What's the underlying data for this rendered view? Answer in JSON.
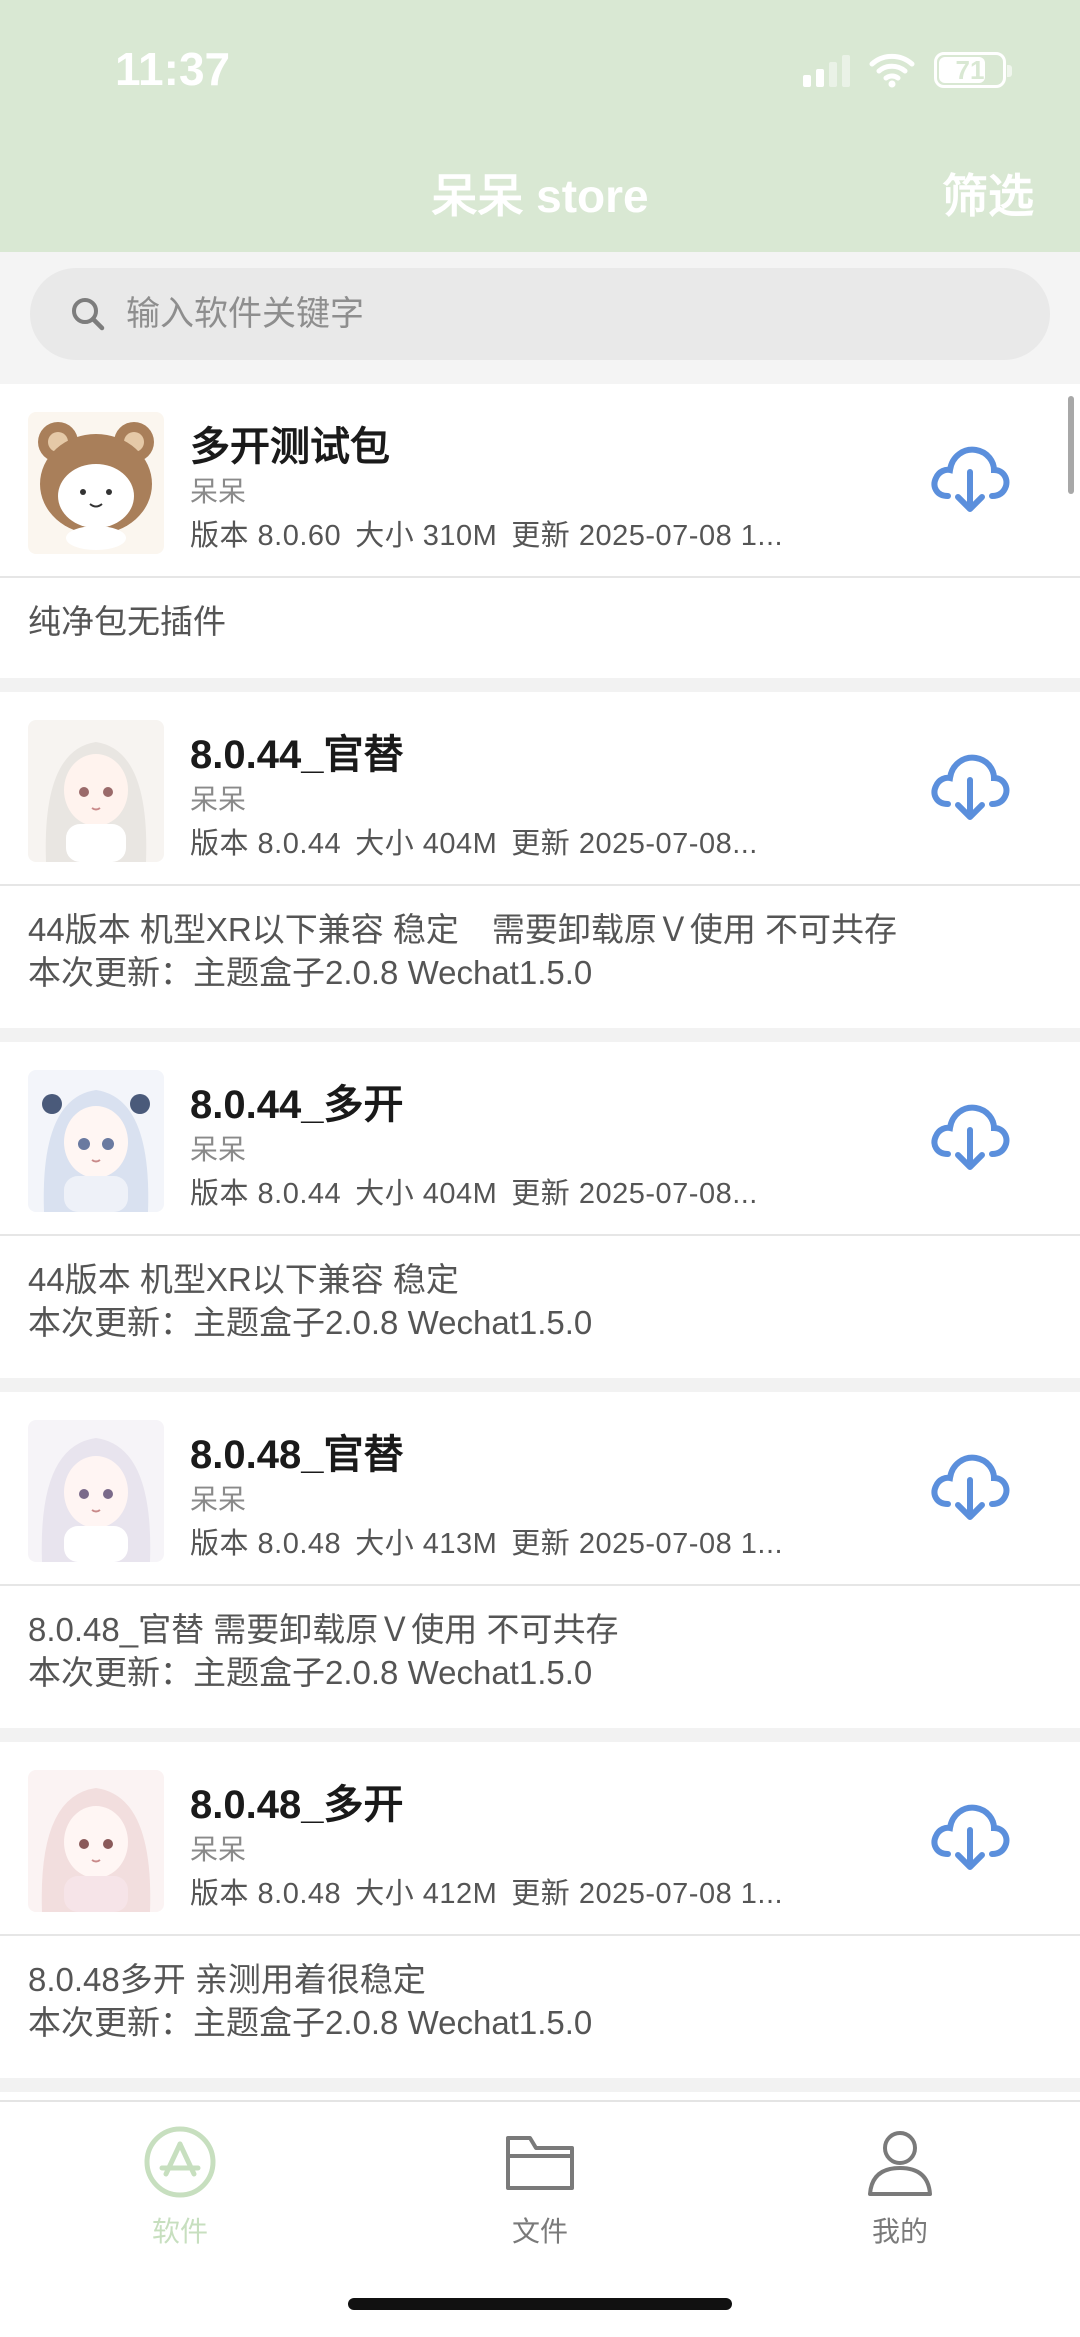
{
  "status_bar": {
    "time": "11:37",
    "battery": "71"
  },
  "header": {
    "title": "呆呆 store",
    "filter_label": "筛选"
  },
  "search": {
    "placeholder": "输入软件关键字",
    "value": ""
  },
  "apps": [
    {
      "name": "多开测试包",
      "author": "呆呆",
      "version": "版本 8.0.60",
      "size": "大小 310M",
      "updated": "更新 2025-07-08 1...",
      "desc_line1": "纯净包无插件",
      "desc_line2": "",
      "thumb_icon": "bear-hood-avatar"
    },
    {
      "name": "8.0.44_官替",
      "author": "呆呆",
      "version": "版本 8.0.44",
      "size": "大小 404M",
      "updated": "更新 2025-07-08...",
      "desc_line1": "44版本 机型XR以下兼容 稳定　需要卸载原Ｖ使用 不可共存",
      "desc_line2": "本次更新：主题盒子2.0.8 Wechat1.5.0",
      "thumb_icon": "anime-girl-avatar"
    },
    {
      "name": "8.0.44_多开",
      "author": "呆呆",
      "version": "版本 8.0.44",
      "size": "大小 404M",
      "updated": "更新 2025-07-08...",
      "desc_line1": "44版本 机型XR以下兼容 稳定",
      "desc_line2": "本次更新：主题盒子2.0.8 Wechat1.5.0",
      "thumb_icon": "anime-girl-avatar"
    },
    {
      "name": "8.0.48_官替",
      "author": "呆呆",
      "version": "版本 8.0.48",
      "size": "大小 413M",
      "updated": "更新 2025-07-08 1...",
      "desc_line1": "8.0.48_官替 需要卸载原Ｖ使用 不可共存",
      "desc_line2": "本次更新：主题盒子2.0.8 Wechat1.5.0",
      "thumb_icon": "anime-girl-avatar"
    },
    {
      "name": "8.0.48_多开",
      "author": "呆呆",
      "version": "版本 8.0.48",
      "size": "大小 412M",
      "updated": "更新 2025-07-08 1...",
      "desc_line1": "8.0.48多开  亲测用着很稳定",
      "desc_line2": "本次更新：主题盒子2.0.8 Wechat1.5.0",
      "thumb_icon": "anime-girl-avatar"
    }
  ],
  "tabbar": {
    "tabs": [
      {
        "label": "软件",
        "icon": "app-store-icon",
        "active": true
      },
      {
        "label": "文件",
        "icon": "folder-icon",
        "active": false
      },
      {
        "label": "我的",
        "icon": "person-icon",
        "active": false
      }
    ]
  },
  "colors": {
    "header_bg": "#d9e8d3",
    "accent_blue": "#5b8fdc",
    "active_tab": "#c7dfbf"
  }
}
